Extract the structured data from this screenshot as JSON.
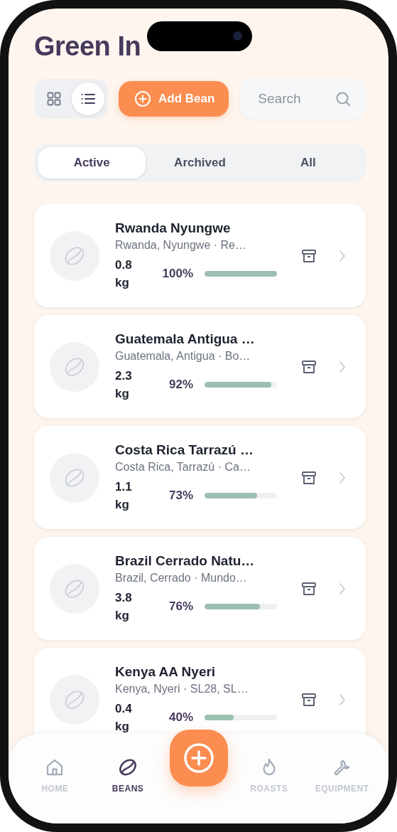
{
  "screen": {
    "title": "Green In"
  },
  "toolbar": {
    "view_toggle": [
      {
        "kind": "grid",
        "selected": false
      },
      {
        "kind": "list",
        "selected": true
      }
    ],
    "add_button": "Add Bean",
    "search": {
      "placeholder": "Search"
    }
  },
  "filter_tabs": [
    {
      "label": "Active",
      "selected": true
    },
    {
      "label": "Archived",
      "selected": false
    },
    {
      "label": "All",
      "selected": false
    }
  ],
  "beans": [
    {
      "name": "Rwanda Nyungwe",
      "origin": "Rwanda, Nyungwe · Re…",
      "weight": "0.8 kg",
      "percent": "100%",
      "level": 1.0
    },
    {
      "name": "Guatemala Antigua …",
      "origin": "Guatemala, Antigua · Bo…",
      "weight": "2.3 kg",
      "percent": "92%",
      "level": 0.92
    },
    {
      "name": "Costa Rica Tarrazú …",
      "origin": "Costa Rica, Tarrazú · Ca…",
      "weight": "1.1 kg",
      "percent": "73%",
      "level": 0.73
    },
    {
      "name": "Brazil Cerrado Natu…",
      "origin": "Brazil, Cerrado · Mundo…",
      "weight": "3.8 kg",
      "percent": "76%",
      "level": 0.76
    },
    {
      "name": "Kenya AA Nyeri",
      "origin": "Kenya, Nyeri · SL28, SL…",
      "weight": "0.4 kg",
      "percent": "40%",
      "level": 0.4
    }
  ],
  "center_button": {
    "kind": "add"
  },
  "bottom_nav": [
    {
      "kind": "home",
      "label": "HOME",
      "selected": false
    },
    {
      "kind": "beans",
      "label": "BEANS",
      "selected": true
    },
    {
      "kind": "roasts",
      "label": "ROASTS",
      "selected": false
    },
    {
      "kind": "equipment",
      "label": "EQUIPMENT",
      "selected": false
    }
  ]
}
